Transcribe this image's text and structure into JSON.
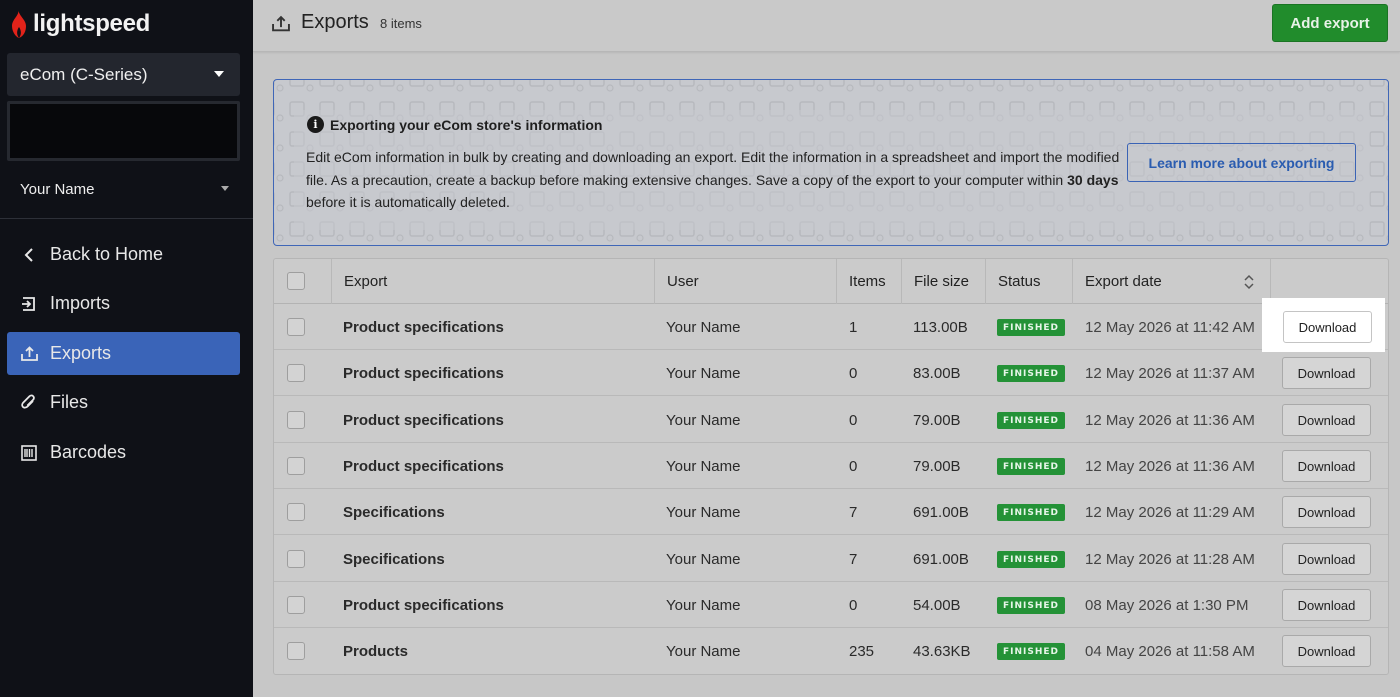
{
  "sidebar": {
    "brand": "lightspeed",
    "store_select": "eCom (C-Series)",
    "user_name": "Your Name",
    "nav": [
      {
        "label": "Back to Home",
        "icon": "chevron-left-icon"
      },
      {
        "label": "Imports",
        "icon": "import-icon"
      },
      {
        "label": "Exports",
        "icon": "export-icon",
        "active": true
      },
      {
        "label": "Files",
        "icon": "paperclip-icon"
      },
      {
        "label": "Barcodes",
        "icon": "barcode-icon"
      }
    ]
  },
  "header": {
    "title": "Exports",
    "count": "8 items",
    "add_button": "Add export"
  },
  "banner": {
    "heading": "Exporting your eCom store's information",
    "text_before": "Edit eCom information in bulk by creating and downloading an export. Edit the information in a spreadsheet and import the modified file. As a precaution, create a backup before making extensive changes. Save a copy of the export to your computer within ",
    "text_bold": "30 days",
    "text_after": " before it is automatically deleted.",
    "learn_button": "Learn more about exporting"
  },
  "table": {
    "columns": [
      "Export",
      "User",
      "Items",
      "File size",
      "Status",
      "Export date"
    ],
    "download_label": "Download",
    "rows": [
      {
        "export": "Product specifications",
        "user": "Your Name",
        "items": "1",
        "size": "113.00B",
        "status": "FINISHED",
        "date": "12 May 2026 at 11:42 AM"
      },
      {
        "export": "Product specifications",
        "user": "Your Name",
        "items": "0",
        "size": "83.00B",
        "status": "FINISHED",
        "date": "12 May 2026 at 11:37 AM"
      },
      {
        "export": "Product specifications",
        "user": "Your Name",
        "items": "0",
        "size": "79.00B",
        "status": "FINISHED",
        "date": "12 May 2026 at 11:36 AM"
      },
      {
        "export": "Product specifications",
        "user": "Your Name",
        "items": "0",
        "size": "79.00B",
        "status": "FINISHED",
        "date": "12 May 2026 at 11:36 AM"
      },
      {
        "export": "Specifications",
        "user": "Your Name",
        "items": "7",
        "size": "691.00B",
        "status": "FINISHED",
        "date": "12 May 2026 at 11:29 AM"
      },
      {
        "export": "Specifications",
        "user": "Your Name",
        "items": "7",
        "size": "691.00B",
        "status": "FINISHED",
        "date": "12 May 2026 at 11:28 AM"
      },
      {
        "export": "Product specifications",
        "user": "Your Name",
        "items": "0",
        "size": "54.00B",
        "status": "FINISHED",
        "date": "08 May 2026 at 1:30 PM"
      },
      {
        "export": "Products",
        "user": "Your Name",
        "items": "235",
        "size": "43.63KB",
        "status": "FINISHED",
        "date": "04 May 2026 at 11:58 AM"
      }
    ]
  },
  "colors": {
    "sidebar_bg": "#0f1117",
    "active_nav": "#3a64b8",
    "add_button": "#218c2c",
    "status_badge": "#249237",
    "link_blue": "#2a5cb0"
  }
}
